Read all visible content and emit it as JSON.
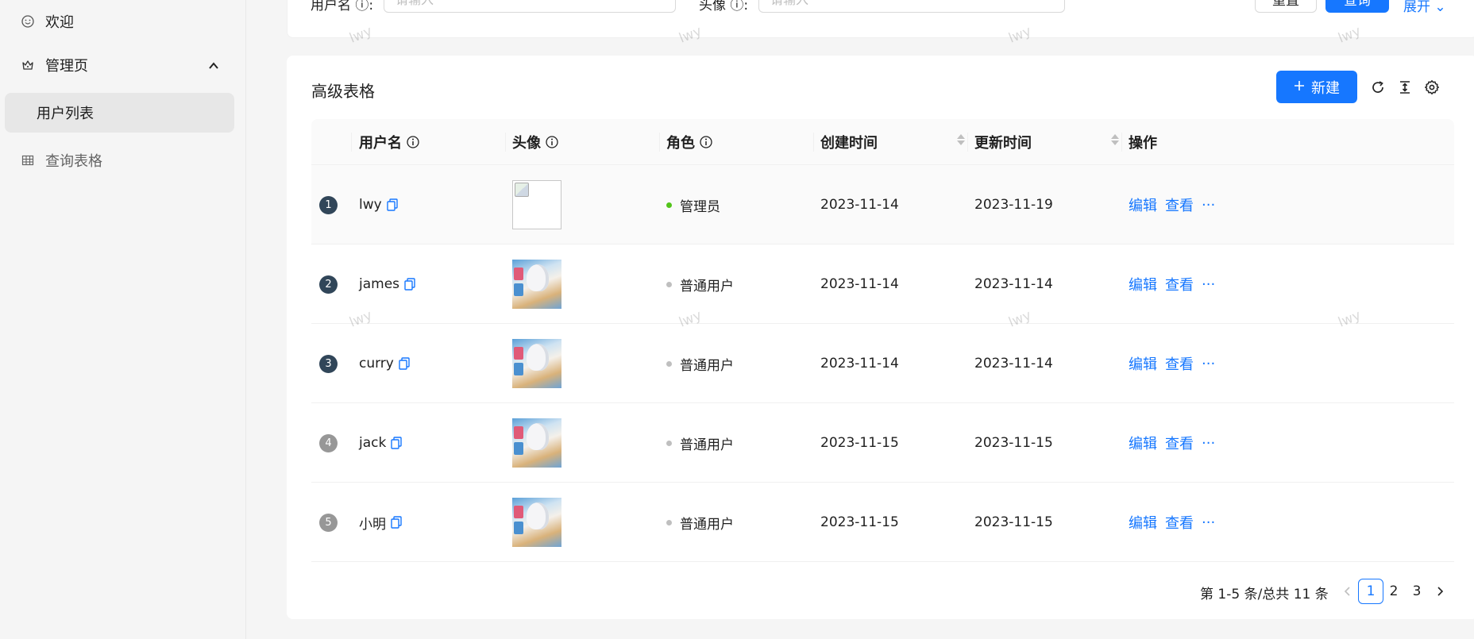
{
  "sidebar": {
    "items": [
      {
        "label": "欢迎"
      },
      {
        "label": "管理页"
      },
      {
        "label": "用户列表"
      },
      {
        "label": "查询表格"
      }
    ]
  },
  "search": {
    "fields": [
      {
        "label": "用户名",
        "placeholder": "请输入"
      },
      {
        "label": "头像",
        "placeholder": "请输入"
      }
    ],
    "reset_label": "重置",
    "query_label": "查询",
    "expand_label": "展开"
  },
  "table": {
    "title": "高级表格",
    "new_label": "新建",
    "columns": [
      "用户名",
      "头像",
      "角色",
      "创建时间",
      "更新时间",
      "操作"
    ],
    "rows": [
      {
        "index": "1",
        "username": "lwy",
        "avatar": "broken",
        "role": "管理员",
        "role_color": "#52c41a",
        "created": "2023-11-14",
        "updated": "2023-11-19",
        "actions": [
          "编辑",
          "查看",
          "···"
        ]
      },
      {
        "index": "2",
        "username": "james",
        "avatar": "image",
        "role": "普通用户",
        "role_color": "#bfbfbf",
        "created": "2023-11-14",
        "updated": "2023-11-14",
        "actions": [
          "编辑",
          "查看",
          "···"
        ]
      },
      {
        "index": "3",
        "username": "curry",
        "avatar": "image",
        "role": "普通用户",
        "role_color": "#bfbfbf",
        "created": "2023-11-14",
        "updated": "2023-11-14",
        "actions": [
          "编辑",
          "查看",
          "···"
        ]
      },
      {
        "index": "4",
        "username": "jack",
        "avatar": "image",
        "role": "普通用户",
        "role_color": "#bfbfbf",
        "created": "2023-11-15",
        "updated": "2023-11-15",
        "actions": [
          "编辑",
          "查看",
          "···"
        ]
      },
      {
        "index": "5",
        "username": "小明",
        "avatar": "image",
        "role": "普通用户",
        "role_color": "#bfbfbf",
        "created": "2023-11-15",
        "updated": "2023-11-15",
        "actions": [
          "编辑",
          "查看",
          "···"
        ]
      }
    ]
  },
  "pagination": {
    "total_text": "第 1-5 条/总共 11 条",
    "pages": [
      "1",
      "2",
      "3"
    ],
    "current": "1"
  },
  "watermark": "lwy",
  "colors": {
    "primary": "#1677ff",
    "admin_dot": "#52c41a",
    "user_dot": "#bfbfbf"
  }
}
